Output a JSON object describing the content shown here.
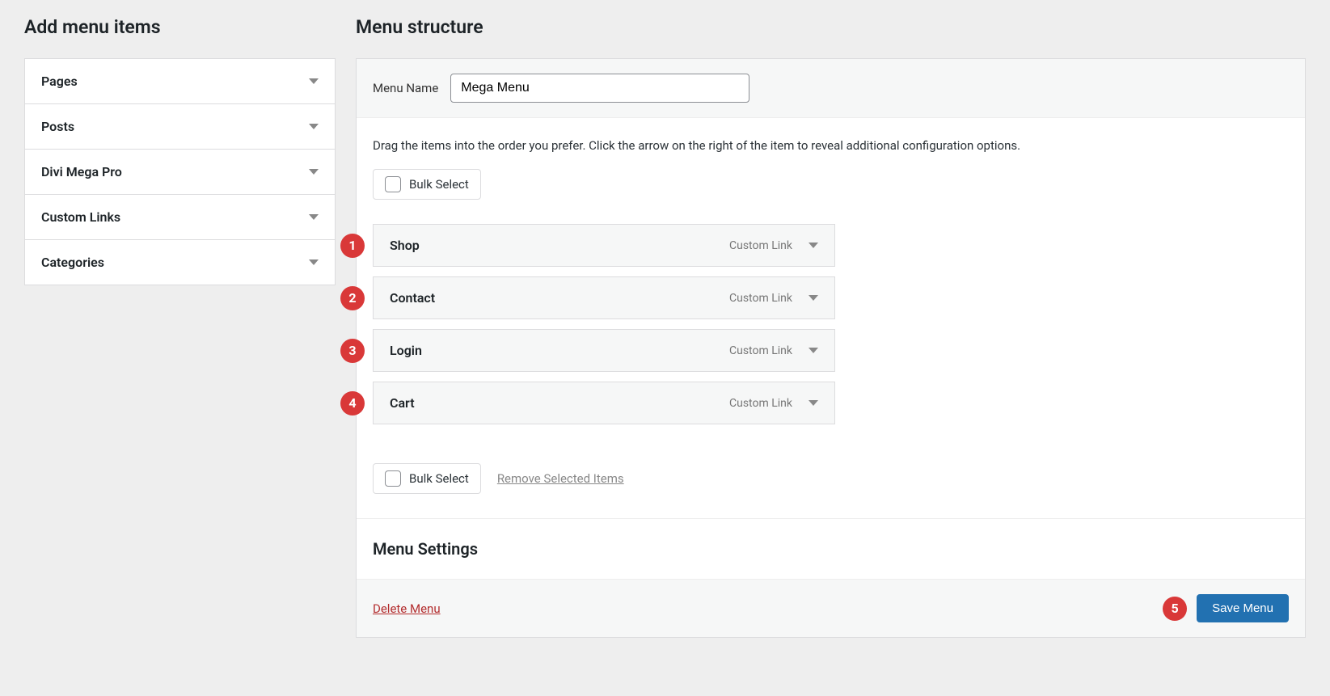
{
  "leftHeading": "Add menu items",
  "rightHeading": "Menu structure",
  "accordion": {
    "items": [
      {
        "label": "Pages"
      },
      {
        "label": "Posts"
      },
      {
        "label": "Divi Mega Pro"
      },
      {
        "label": "Custom Links"
      },
      {
        "label": "Categories"
      }
    ]
  },
  "menuNameLabel": "Menu Name",
  "menuNameValue": "Mega Menu",
  "instructions": "Drag the items into the order you prefer. Click the arrow on the right of the item to reveal additional configuration options.",
  "bulkSelectLabel": "Bulk Select",
  "menuItems": [
    {
      "label": "Shop",
      "type": "Custom Link",
      "annotation": "1"
    },
    {
      "label": "Contact",
      "type": "Custom Link",
      "annotation": "2"
    },
    {
      "label": "Login",
      "type": "Custom Link",
      "annotation": "3"
    },
    {
      "label": "Cart",
      "type": "Custom Link",
      "annotation": "4"
    }
  ],
  "removeSelectedLabel": "Remove Selected Items",
  "menuSettingsHeading": "Menu Settings",
  "deleteMenuLabel": "Delete Menu",
  "saveMenuLabel": "Save Menu",
  "saveAnnotation": "5"
}
